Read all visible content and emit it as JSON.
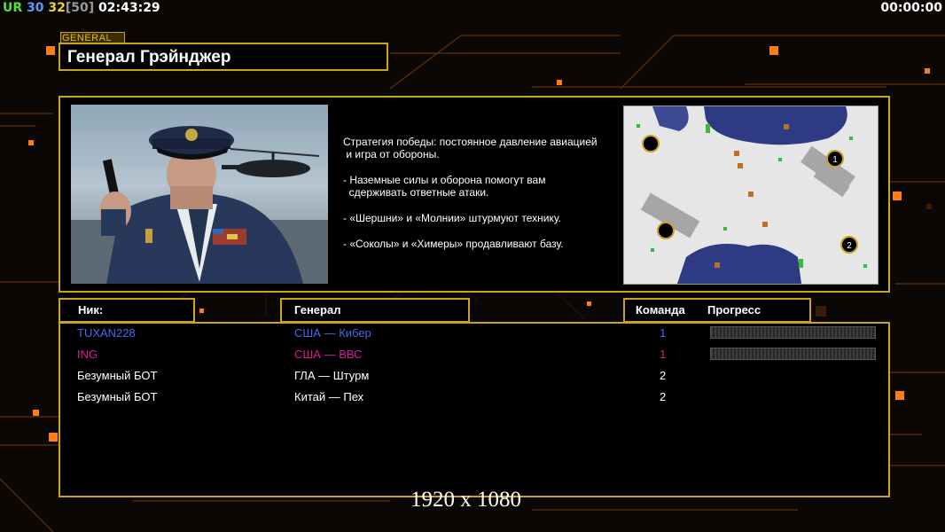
{
  "topbar": {
    "ur_label": "UR",
    "fps": "30",
    "fps_current": "32",
    "fps_limit": "[50]",
    "clock": "02:43:29",
    "timer": "00:00:00"
  },
  "header": {
    "tag": "GENERAL",
    "title": "Генерал Грэйнджер"
  },
  "briefing": [
    "Стратегия победы: постоянное давление авиацией\n и игра от обороны.",
    "- Наземные силы и оборона помогут вам\n  сдерживать ответные атаки.",
    "- «Шершни» и «Молнии» штурмуют технику.",
    "- «Соколы» и «Химеры» продавливают базу."
  ],
  "map": {
    "start_labels": [
      "1",
      "2"
    ]
  },
  "columns": {
    "nick": "Ник:",
    "general": "Генерал",
    "team": "Команда",
    "progress": "Прогресс"
  },
  "players": [
    {
      "nick": "TUXAN228",
      "general": "США — Кибер",
      "team": "1",
      "color": "#3f6cf0",
      "has_progress": true
    },
    {
      "nick": "ING",
      "general": "США — ВВС",
      "team": "1",
      "color": "#d81e9a",
      "has_progress": true
    },
    {
      "nick": "Безумный БОТ",
      "general": "ГЛА — Штурм",
      "team": "2",
      "color": "#ffffff",
      "has_progress": false
    },
    {
      "nick": "Безумный БОТ",
      "general": "Китай — Пех",
      "team": "2",
      "color": "#ffffff",
      "has_progress": false
    }
  ],
  "resolution": "1920 x 1080",
  "colors": {
    "frame_gold": "#c9a41c",
    "accent_orange": "#ff8a1c",
    "ur_green": "#52e23a",
    "fps_blue": "#5a9cff",
    "fps_yellow": "#f2d22a",
    "fps_gray": "#9a9a9a"
  }
}
